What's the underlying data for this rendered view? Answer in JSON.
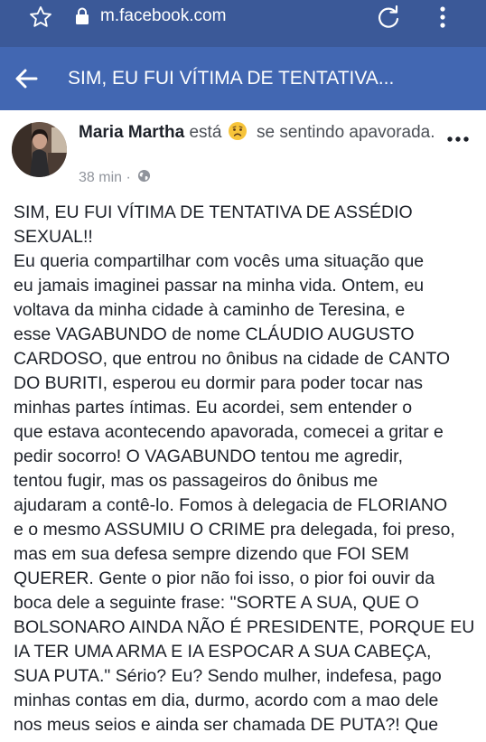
{
  "browser": {
    "url": "m.facebook.com"
  },
  "header": {
    "title": "SIM, EU FUI VÍTIMA DE TENTATIVA..."
  },
  "post": {
    "author": "Maria Martha",
    "feeling_prefix": "está",
    "feeling_emoji": "worried-face",
    "feeling_text": "se sentindo apavorada.",
    "time": "38 min · ",
    "privacy_icon": "globe-icon",
    "body_lines": [
      "SIM, EU FUI VÍTIMA DE TENTATIVA DE ASSÉDIO",
      "SEXUAL!!",
      "Eu queria compartilhar com vocês uma situação que",
      "eu jamais imaginei passar na minha vida. Ontem, eu",
      "voltava da minha cidade à caminho de Teresina, e",
      "esse VAGABUNDO de nome CLÁUDIO AUGUSTO",
      "CARDOSO, que entrou no ônibus na cidade de CANTO",
      "DO BURITI, esperou eu dormir para poder tocar nas",
      "minhas partes íntimas. Eu acordei, sem entender o",
      "que estava acontecendo apavorada, comecei a gritar e",
      "pedir socorro! O VAGABUNDO tentou me agredir,",
      "tentou fugir, mas os passageiros do ônibus me",
      "ajudaram a contê-lo. Fomos à delegacia de FLORIANO",
      "e o mesmo ASSUMIU O CRIME pra delegada, foi preso,",
      "mas em sua defesa sempre dizendo que FOI SEM",
      "QUERER. Gente o pior não foi isso, o pior foi ouvir da",
      "boca dele a seguinte frase: \"SORTE A SUA, QUE O",
      "BOLSONARO AINDA NÃO É PRESIDENTE, PORQUE EU",
      "IA TER UMA ARMA E IA ESPOCAR A SUA CABEÇA,",
      "SUA PUTA.\" Sério? Eu? Sendo mulher, indefesa, pago",
      "minhas contas em dia, durmo, acordo com a mao dele",
      "nos meus seios e ainda ser chamada DE PUTA?! Que"
    ]
  },
  "colors": {
    "browser_bar": "#3b5998",
    "title_bar": "#4267b2",
    "text": "#1d2129",
    "meta": "#90949c"
  }
}
